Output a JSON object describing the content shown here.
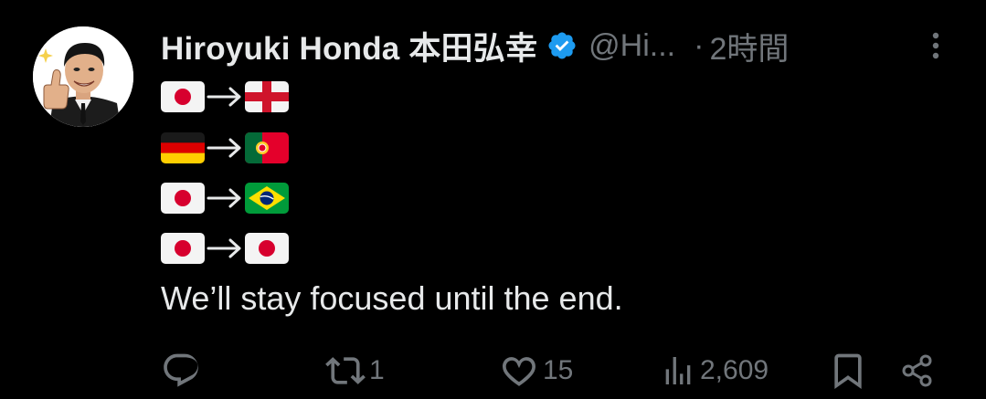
{
  "tweet": {
    "author": {
      "display_name": "Hiroyuki Honda 本田弘幸",
      "handle": "@Hi...",
      "verified": true,
      "avatar_icon": "profile-photo-thumbs-up"
    },
    "separator": "·",
    "timestamp": "2時間",
    "more_icon": "more-vertical-icon",
    "lines": [
      {
        "from": "Japan flag",
        "arrow": "→",
        "to": "England flag"
      },
      {
        "from": "Germany flag",
        "arrow": "→",
        "to": "Portugal flag"
      },
      {
        "from": "Japan flag",
        "arrow": "→",
        "to": "Brazil flag"
      },
      {
        "from": "Japan flag",
        "arrow": "→",
        "to": "Japan flag"
      }
    ],
    "text": "We’ll stay focused until the end.",
    "actions": {
      "reply": {
        "icon": "reply-icon",
        "count": ""
      },
      "retweet": {
        "icon": "retweet-icon",
        "count": "1"
      },
      "like": {
        "icon": "heart-icon",
        "count": "15"
      },
      "views": {
        "icon": "views-icon",
        "count": "2,609"
      },
      "bookmark": {
        "icon": "bookmark-icon"
      },
      "share": {
        "icon": "share-icon"
      }
    }
  },
  "colors": {
    "background": "#000000",
    "primary_text": "#e7e9ea",
    "secondary_text": "#71767b",
    "verified_badge": "#1d9bf0"
  }
}
